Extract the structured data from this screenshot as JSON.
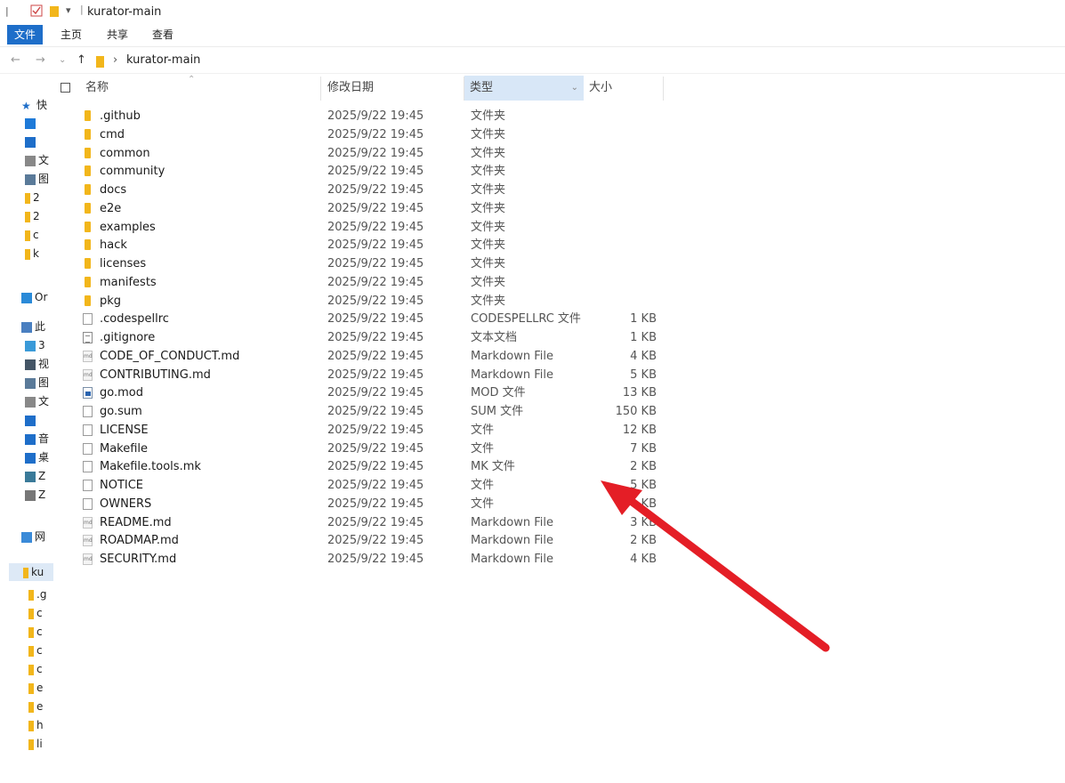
{
  "window": {
    "title": "kurator-main"
  },
  "ribbon": {
    "tabs": [
      "文件",
      "主页",
      "共享",
      "查看"
    ]
  },
  "address": {
    "path": "kurator-main"
  },
  "sidebar": {
    "items": [
      "快",
      "",
      "",
      "文",
      "图",
      "2",
      "2",
      "c",
      "k",
      "Or",
      "此",
      "3",
      "视",
      "图",
      "文",
      "",
      "音",
      "桌",
      "Z",
      "Z",
      "网",
      "ku",
      ".g",
      "c",
      "c",
      "c",
      "c",
      "e",
      "e",
      "h",
      "li"
    ]
  },
  "columns": {
    "name": "名称",
    "modified": "修改日期",
    "type": "类型",
    "size": "大小"
  },
  "files": [
    {
      "name": ".github",
      "date": "2025/9/22 19:45",
      "type": "文件夹",
      "size": "",
      "icon": "folder-icon"
    },
    {
      "name": "cmd",
      "date": "2025/9/22 19:45",
      "type": "文件夹",
      "size": "",
      "icon": "folder-icon"
    },
    {
      "name": "common",
      "date": "2025/9/22 19:45",
      "type": "文件夹",
      "size": "",
      "icon": "folder-icon"
    },
    {
      "name": "community",
      "date": "2025/9/22 19:45",
      "type": "文件夹",
      "size": "",
      "icon": "folder-icon"
    },
    {
      "name": "docs",
      "date": "2025/9/22 19:45",
      "type": "文件夹",
      "size": "",
      "icon": "folder-icon"
    },
    {
      "name": "e2e",
      "date": "2025/9/22 19:45",
      "type": "文件夹",
      "size": "",
      "icon": "folder-icon"
    },
    {
      "name": "examples",
      "date": "2025/9/22 19:45",
      "type": "文件夹",
      "size": "",
      "icon": "folder-icon"
    },
    {
      "name": "hack",
      "date": "2025/9/22 19:45",
      "type": "文件夹",
      "size": "",
      "icon": "folder-icon"
    },
    {
      "name": "licenses",
      "date": "2025/9/22 19:45",
      "type": "文件夹",
      "size": "",
      "icon": "folder-icon"
    },
    {
      "name": "manifests",
      "date": "2025/9/22 19:45",
      "type": "文件夹",
      "size": "",
      "icon": "folder-icon"
    },
    {
      "name": "pkg",
      "date": "2025/9/22 19:45",
      "type": "文件夹",
      "size": "",
      "icon": "folder-icon"
    },
    {
      "name": ".codespellrc",
      "date": "2025/9/22 19:45",
      "type": "CODESPELLRC 文件",
      "size": "1 KB",
      "icon": "file-icon"
    },
    {
      "name": ".gitignore",
      "date": "2025/9/22 19:45",
      "type": "文本文档",
      "size": "1 KB",
      "icon": "text-file-icon"
    },
    {
      "name": "CODE_OF_CONDUCT.md",
      "date": "2025/9/22 19:45",
      "type": "Markdown File",
      "size": "4 KB",
      "icon": "markdown-file-icon"
    },
    {
      "name": "CONTRIBUTING.md",
      "date": "2025/9/22 19:45",
      "type": "Markdown File",
      "size": "5 KB",
      "icon": "markdown-file-icon"
    },
    {
      "name": "go.mod",
      "date": "2025/9/22 19:45",
      "type": "MOD 文件",
      "size": "13 KB",
      "icon": "go-mod-file-icon"
    },
    {
      "name": "go.sum",
      "date": "2025/9/22 19:45",
      "type": "SUM 文件",
      "size": "150 KB",
      "icon": "file-icon"
    },
    {
      "name": "LICENSE",
      "date": "2025/9/22 19:45",
      "type": "文件",
      "size": "12 KB",
      "icon": "file-icon"
    },
    {
      "name": "Makefile",
      "date": "2025/9/22 19:45",
      "type": "文件",
      "size": "7 KB",
      "icon": "file-icon"
    },
    {
      "name": "Makefile.tools.mk",
      "date": "2025/9/22 19:45",
      "type": "MK 文件",
      "size": "2 KB",
      "icon": "file-icon"
    },
    {
      "name": "NOTICE",
      "date": "2025/9/22 19:45",
      "type": "文件",
      "size": "5 KB",
      "icon": "file-icon"
    },
    {
      "name": "OWNERS",
      "date": "2025/9/22 19:45",
      "type": "文件",
      "size": "KB",
      "icon": "file-icon"
    },
    {
      "name": "README.md",
      "date": "2025/9/22 19:45",
      "type": "Markdown File",
      "size": "3 KB",
      "icon": "markdown-file-icon"
    },
    {
      "name": "ROADMAP.md",
      "date": "2025/9/22 19:45",
      "type": "Markdown File",
      "size": "2 KB",
      "icon": "markdown-file-icon"
    },
    {
      "name": "SECURITY.md",
      "date": "2025/9/22 19:45",
      "type": "Markdown File",
      "size": "4 KB",
      "icon": "markdown-file-icon"
    }
  ],
  "annotation": {
    "arrow_color": "#e41e26"
  },
  "colors": {
    "folder": "#f2b61b",
    "file_tab": "#1e6ec9",
    "selected_header": "#d8e7f7"
  }
}
